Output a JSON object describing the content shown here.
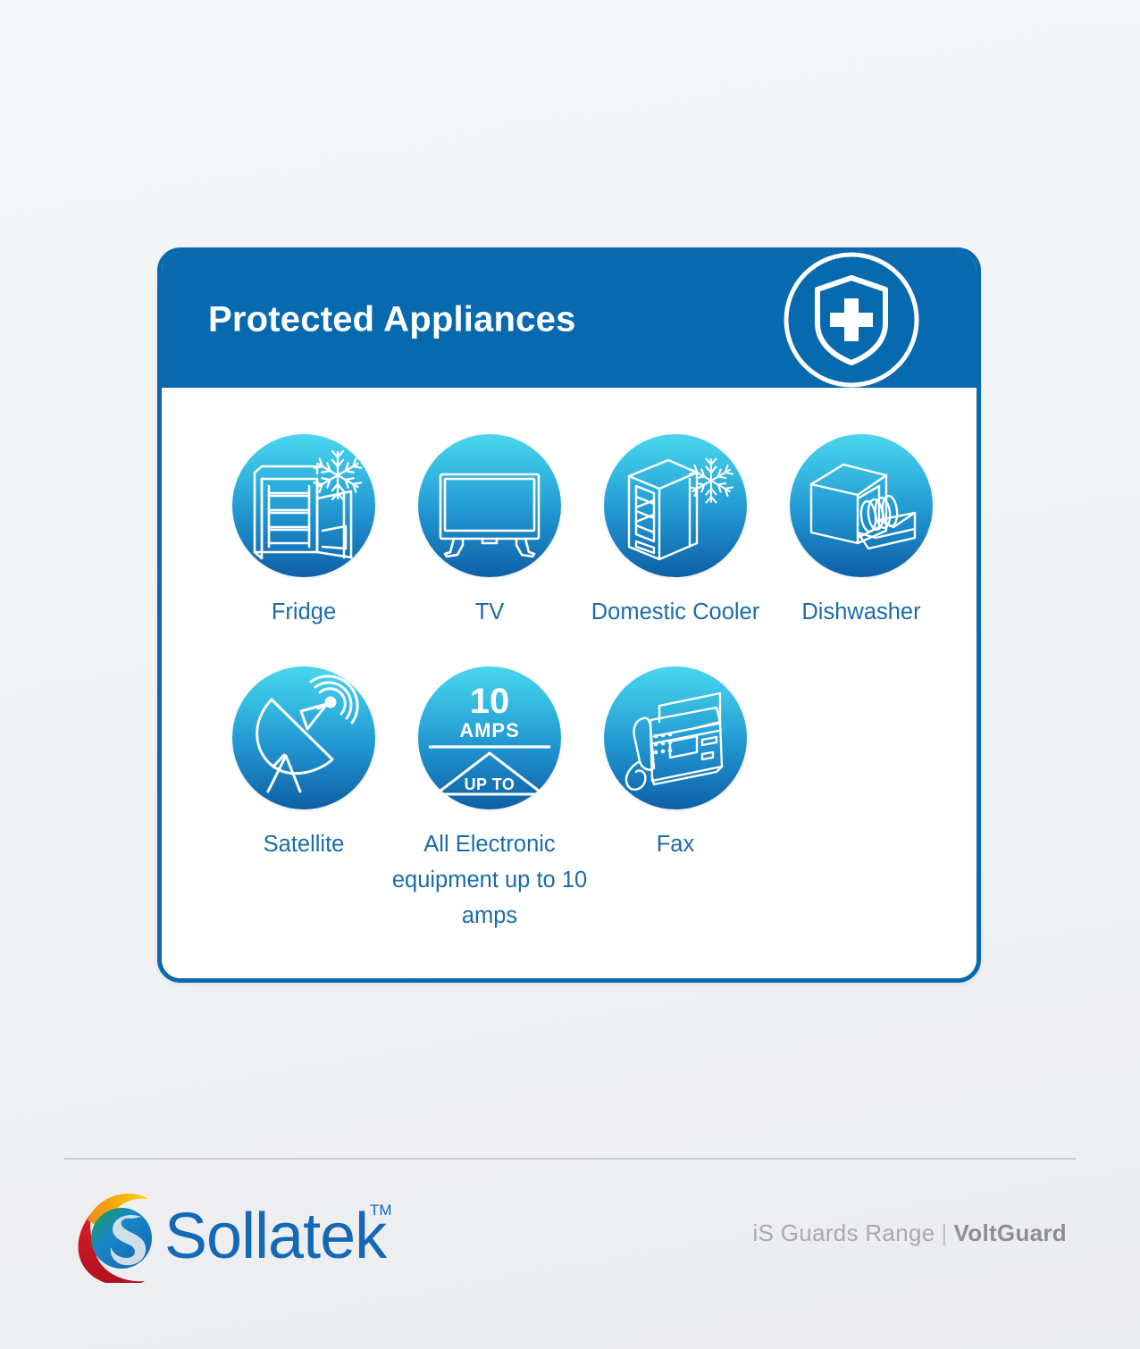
{
  "card": {
    "title": "Protected Appliances",
    "badge_icon": "shield-plus-icon",
    "header_color": "#0769AE",
    "border_color": "#0A69AD",
    "label_color": "#1A6CAB"
  },
  "appliances": {
    "rows": [
      [
        {
          "label": "Fridge",
          "icon": "fridge-icon"
        },
        {
          "label": "TV",
          "icon": "tv-icon"
        },
        {
          "label": "Domestic Cooler",
          "icon": "domestic-cooler-icon"
        },
        {
          "label": "Dishwasher",
          "icon": "dishwasher-icon"
        }
      ],
      [
        {
          "label": "Satellite",
          "icon": "satellite-dish-icon"
        },
        {
          "label": "All Electronic equipment up to 10 amps",
          "icon": "ten-amps-icon"
        },
        {
          "label": "Fax",
          "icon": "fax-machine-icon"
        }
      ]
    ]
  },
  "amps_badge": {
    "value": "10",
    "unit": "AMPS",
    "qualifier": "UP TO"
  },
  "footer": {
    "logo_text": "Sollatek",
    "logo_tm": "TM",
    "range_label": "iS Guards Range",
    "separator": "|",
    "product_label": "VoltGuard"
  }
}
